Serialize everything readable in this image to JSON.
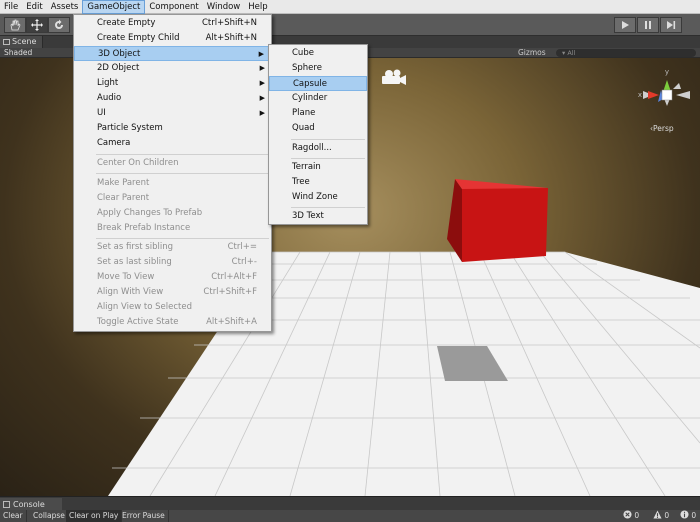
{
  "menubar": {
    "items": [
      "File",
      "Edit",
      "Assets",
      "GameObject",
      "Component",
      "Window",
      "Help"
    ]
  },
  "toolbar": {
    "tools": [
      "hand-icon",
      "move-icon",
      "rotate-icon"
    ],
    "playback": [
      "play-icon",
      "pause-icon",
      "step-icon"
    ]
  },
  "scene": {
    "tab_label": "Scene",
    "shading_mode": "Shaded",
    "gizmos_label": "Gizmos",
    "search_text": "▾ All",
    "persp_label": "‹Persp",
    "gizmo_axes": {
      "y": "y",
      "x": "x"
    }
  },
  "gameobject_menu": {
    "items": [
      {
        "label": "Create Empty",
        "shortcut": "Ctrl+Shift+N",
        "enabled": true
      },
      {
        "label": "Create Empty Child",
        "shortcut": "Alt+Shift+N",
        "enabled": true
      },
      {
        "label": "3D Object",
        "submenu": true,
        "enabled": true,
        "highlighted": true
      },
      {
        "label": "2D Object",
        "submenu": true,
        "enabled": true
      },
      {
        "label": "Light",
        "submenu": true,
        "enabled": true
      },
      {
        "label": "Audio",
        "submenu": true,
        "enabled": true
      },
      {
        "label": "UI",
        "submenu": true,
        "enabled": true
      },
      {
        "label": "Particle System",
        "enabled": true
      },
      {
        "label": "Camera",
        "enabled": true
      },
      {
        "label": "Center On Children",
        "enabled": false
      },
      {
        "label": "Make Parent",
        "enabled": false
      },
      {
        "label": "Clear Parent",
        "enabled": false
      },
      {
        "label": "Apply Changes To Prefab",
        "enabled": false
      },
      {
        "label": "Break Prefab Instance",
        "enabled": false
      },
      {
        "label": "Set as first sibling",
        "shortcut": "Ctrl+=",
        "enabled": false
      },
      {
        "label": "Set as last sibling",
        "shortcut": "Ctrl+-",
        "enabled": false
      },
      {
        "label": "Move To View",
        "shortcut": "Ctrl+Alt+F",
        "enabled": false
      },
      {
        "label": "Align With View",
        "shortcut": "Ctrl+Shift+F",
        "enabled": false
      },
      {
        "label": "Align View to Selected",
        "enabled": false
      },
      {
        "label": "Toggle Active State",
        "shortcut": "Alt+Shift+A",
        "enabled": false
      }
    ]
  },
  "object3d_submenu": {
    "items": [
      {
        "label": "Cube"
      },
      {
        "label": "Sphere"
      },
      {
        "label": "Capsule",
        "highlighted": true
      },
      {
        "label": "Cylinder"
      },
      {
        "label": "Plane"
      },
      {
        "label": "Quad"
      },
      {
        "label": "Ragdoll..."
      },
      {
        "label": "Terrain"
      },
      {
        "label": "Tree"
      },
      {
        "label": "Wind Zone"
      },
      {
        "label": "3D Text"
      }
    ]
  },
  "console": {
    "tab_label": "Console",
    "buttons": [
      "Clear",
      "Collapse",
      "Clear on Play",
      "Error Pause"
    ],
    "counts": {
      "errors": "0",
      "warnings": "0",
      "messages": "0"
    }
  },
  "colors": {
    "cube": "#c81414",
    "highlight": "#a8cef1",
    "grid": "#f2f2f2"
  }
}
